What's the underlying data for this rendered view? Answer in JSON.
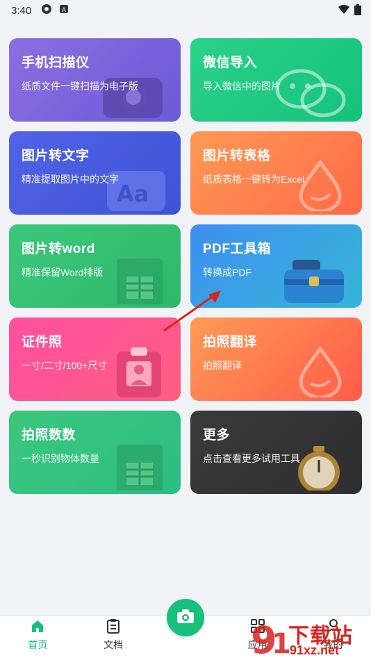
{
  "status_bar": {
    "time": "3:40",
    "icons": [
      "android-icon",
      "a-badge-icon",
      "wifi-icon",
      "battery-icon"
    ]
  },
  "cards": [
    {
      "title": "手机扫描仪",
      "subtitle": "纸质文件一键扫描为电子版",
      "color": "#7a63dc",
      "icon": "scanner-camera-icon"
    },
    {
      "title": "微信导入",
      "subtitle": "导入微信中的图片",
      "color": "#1fc983",
      "icon": "wechat-icon"
    },
    {
      "title": "图片转文字",
      "subtitle": "精准提取图片中的文字",
      "color": "#4a5ee2",
      "icon": "text-aa-icon"
    },
    {
      "title": "图片转表格",
      "subtitle": "纸质表格一键转为Excel",
      "color": "#ff7c4e",
      "icon": "drop-icon"
    },
    {
      "title": "图片转word",
      "subtitle": "精准保留Word排版",
      "color": "#35c073",
      "icon": "word-doc-icon"
    },
    {
      "title": "PDF工具箱",
      "subtitle": "转换成PDF",
      "color": "#39a3e2",
      "icon": "toolbox-icon"
    },
    {
      "title": "证件照",
      "subtitle": "一寸/二寸/100+尺寸",
      "color": "#ff5690",
      "icon": "id-badge-icon"
    },
    {
      "title": "拍照翻译",
      "subtitle": "拍照翻译",
      "color": "#ff7a50",
      "icon": "drop-icon"
    },
    {
      "title": "拍照数数",
      "subtitle": "一秒识别物体数量",
      "color": "#35c07c",
      "icon": "sheet-icon"
    },
    {
      "title": "更多",
      "subtitle": "点击查看更多试用工具",
      "color": "#353535",
      "icon": "stopwatch-icon"
    }
  ],
  "bottom_nav": {
    "items": [
      {
        "label": "首页",
        "active": true
      },
      {
        "label": "文档",
        "active": false
      },
      {
        "label": "应用",
        "active": false
      },
      {
        "label": "我的",
        "active": false
      }
    ],
    "accent": "#17c07b"
  },
  "watermark": {
    "big": "下载站",
    "small": "91xz.net"
  }
}
